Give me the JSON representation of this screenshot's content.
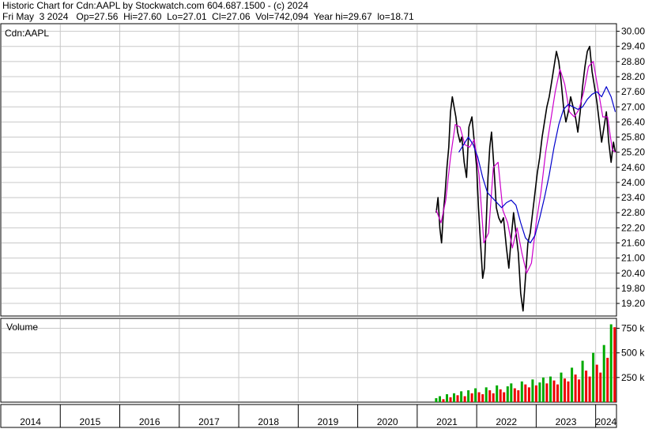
{
  "header": {
    "line1": "Historic Chart for Cdn:AAPL by Stockwatch.com 604.687.1500 - (c) 2024",
    "line2": "Fri May  3 2024   Op=27.56  Hi=27.60  Lo=27.01  Cl=27.06  Vol=742,094  Year hi=29.67  lo=18.71"
  },
  "colors": {
    "price": "#000000",
    "ma_short": "#cc00cc",
    "ma_long": "#0000cc",
    "vol_up": "#00aa00",
    "vol_down": "#ee0000",
    "grid": "#c8c8c8"
  },
  "chart_data": [
    {
      "type": "line",
      "label": "Cdn:AAPL",
      "y_ticks": [
        "30.00",
        "29.40",
        "28.80",
        "28.20",
        "27.60",
        "27.00",
        "26.40",
        "25.80",
        "25.20",
        "24.60",
        "24.00",
        "23.40",
        "22.80",
        "22.20",
        "21.60",
        "21.00",
        "20.40",
        "19.80",
        "19.20"
      ],
      "ylim": [
        18.7,
        30.3
      ],
      "x_ticks": [
        "2014",
        "2015",
        "2016",
        "2017",
        "2018",
        "2019",
        "2020",
        "2021",
        "2022",
        "2023",
        "2024"
      ],
      "xlim": [
        2014.0,
        2024.35
      ],
      "grid": true,
      "series": [
        {
          "x": [
            2021.32,
            2021.35,
            2021.38,
            2021.41,
            2021.44,
            2021.47,
            2021.5,
            2021.53,
            2021.56,
            2021.59,
            2021.62,
            2021.65,
            2021.68,
            2021.72,
            2021.75,
            2021.79,
            2021.83,
            2021.87,
            2021.92,
            2021.96,
            2022.0,
            2022.03,
            2022.06,
            2022.1,
            2022.13,
            2022.16,
            2022.19,
            2022.22,
            2022.25,
            2022.29,
            2022.33,
            2022.37,
            2022.41,
            2022.45,
            2022.5,
            2022.54,
            2022.58,
            2022.62,
            2022.66,
            2022.7,
            2022.74,
            2022.78,
            2022.82,
            2022.86,
            2022.9,
            2022.94,
            2022.98,
            2023.02,
            2023.06,
            2023.1,
            2023.14,
            2023.18,
            2023.22,
            2023.26,
            2023.3,
            2023.34,
            2023.38,
            2023.42,
            2023.46,
            2023.5,
            2023.54,
            2023.58,
            2023.62,
            2023.66,
            2023.7,
            2023.74,
            2023.78,
            2023.82,
            2023.86,
            2023.9,
            2023.94,
            2023.98,
            2024.02,
            2024.06,
            2024.1,
            2024.14,
            2024.18,
            2024.22,
            2024.26,
            2024.3,
            2024.33
          ],
          "y": [
            22.8,
            23.4,
            22.2,
            21.6,
            22.8,
            23.6,
            24.6,
            25.4,
            26.8,
            27.4,
            27.0,
            26.6,
            26.0,
            25.6,
            25.8,
            24.8,
            24.2,
            26.2,
            26.6,
            25.6,
            24.6,
            23.0,
            21.8,
            20.2,
            20.6,
            22.4,
            24.2,
            25.4,
            26.0,
            24.6,
            23.0,
            22.6,
            22.4,
            22.6,
            21.4,
            20.6,
            21.8,
            22.8,
            22.0,
            21.2,
            19.6,
            18.9,
            20.2,
            21.6,
            22.0,
            22.8,
            23.6,
            24.4,
            25.0,
            25.8,
            26.4,
            27.0,
            27.4,
            28.0,
            28.6,
            29.2,
            28.8,
            28.0,
            27.0,
            26.4,
            26.8,
            27.4,
            27.0,
            26.6,
            26.0,
            26.8,
            27.8,
            28.6,
            29.2,
            29.4,
            28.4,
            27.8,
            27.2,
            26.4,
            25.6,
            26.2,
            26.8,
            25.6,
            24.8,
            25.6,
            25.2
          ]
        },
        {
          "x": [
            2021.32,
            2021.4,
            2021.48,
            2021.56,
            2021.64,
            2021.72,
            2021.8,
            2021.88,
            2021.96,
            2022.04,
            2022.12,
            2022.2,
            2022.28,
            2022.36,
            2022.44,
            2022.52,
            2022.6,
            2022.68,
            2022.76,
            2022.84,
            2022.92,
            2023.0,
            2023.08,
            2023.16,
            2023.24,
            2023.32,
            2023.4,
            2023.48,
            2023.56,
            2023.64,
            2023.72,
            2023.8,
            2023.88,
            2023.96,
            2024.04,
            2024.12,
            2024.2,
            2024.28,
            2024.33
          ],
          "y": [
            22.9,
            22.4,
            23.3,
            25.0,
            26.3,
            26.2,
            25.5,
            25.4,
            25.7,
            24.3,
            21.6,
            22.0,
            24.6,
            24.8,
            22.9,
            22.4,
            21.4,
            22.2,
            21.2,
            20.4,
            20.8,
            22.4,
            23.6,
            25.2,
            26.4,
            27.6,
            28.5,
            27.9,
            26.8,
            26.6,
            26.9,
            27.6,
            28.6,
            28.8,
            27.7,
            26.6,
            26.6,
            25.3,
            25.2
          ]
        },
        {
          "x": [
            2021.7,
            2021.78,
            2021.86,
            2021.94,
            2022.02,
            2022.1,
            2022.18,
            2022.26,
            2022.34,
            2022.42,
            2022.5,
            2022.58,
            2022.66,
            2022.74,
            2022.82,
            2022.9,
            2022.98,
            2023.06,
            2023.14,
            2023.22,
            2023.3,
            2023.38,
            2023.46,
            2023.54,
            2023.62,
            2023.7,
            2023.78,
            2023.86,
            2023.94,
            2024.02,
            2024.1,
            2024.18,
            2024.26,
            2024.33
          ],
          "y": [
            25.2,
            25.5,
            25.8,
            25.5,
            25.0,
            24.2,
            23.6,
            23.4,
            23.2,
            23.0,
            23.2,
            23.3,
            23.1,
            22.4,
            21.8,
            21.6,
            21.9,
            22.6,
            23.4,
            24.3,
            25.4,
            26.3,
            26.9,
            27.1,
            27.0,
            26.9,
            27.0,
            27.3,
            27.5,
            27.6,
            27.4,
            27.8,
            27.4,
            26.8
          ]
        }
      ]
    },
    {
      "type": "bar",
      "label": "Volume",
      "y_ticks": [
        "750 k",
        "500 k",
        "250 k"
      ],
      "ylim": [
        0,
        850
      ],
      "grid": true,
      "series": [
        {
          "x": [
            2021.32,
            2021.38,
            2021.44,
            2021.5,
            2021.56,
            2021.62,
            2021.68,
            2021.74,
            2021.8,
            2021.86,
            2021.92,
            2021.98,
            2022.04,
            2022.1,
            2022.16,
            2022.22,
            2022.28,
            2022.34,
            2022.4,
            2022.46,
            2022.52,
            2022.58,
            2022.64,
            2022.7,
            2022.76,
            2022.82,
            2022.88,
            2022.94,
            2023.0,
            2023.06,
            2023.12,
            2023.18,
            2023.24,
            2023.3,
            2023.36,
            2023.42,
            2023.48,
            2023.54,
            2023.6,
            2023.66,
            2023.72,
            2023.78,
            2023.84,
            2023.9,
            2023.96,
            2024.02,
            2024.08,
            2024.14,
            2024.2,
            2024.26,
            2024.32
          ],
          "values": [
            40,
            60,
            30,
            80,
            50,
            90,
            70,
            110,
            60,
            120,
            90,
            140,
            100,
            80,
            150,
            120,
            90,
            170,
            130,
            100,
            160,
            190,
            140,
            120,
            210,
            180,
            150,
            230,
            170,
            200,
            250,
            190,
            260,
            220,
            180,
            300,
            240,
            210,
            350,
            280,
            230,
            420,
            320,
            260,
            500,
            380,
            300,
            580,
            450,
            790,
            760
          ]
        }
      ]
    }
  ]
}
